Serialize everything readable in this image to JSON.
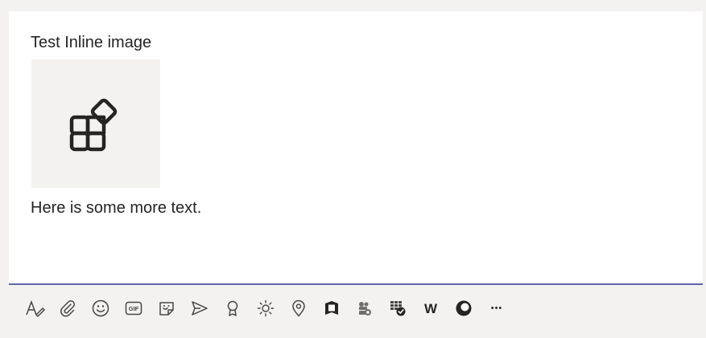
{
  "message": {
    "line1": "Test Inline image",
    "line2": "Here is some more text.",
    "inline_image_icon": "apps-icon"
  },
  "toolbar": {
    "accent": "#6264a7",
    "gif_label": "GIF",
    "w_label": "W",
    "more_label": "•••",
    "items": [
      "format-icon",
      "attach-icon",
      "emoji-icon",
      "gif-icon",
      "sticker-icon",
      "send-icon",
      "praise-icon",
      "sun-icon",
      "location-icon",
      "bookmark-icon",
      "app-icon",
      "planner-icon",
      "word-icon",
      "circle-app-icon",
      "more-icon"
    ]
  }
}
